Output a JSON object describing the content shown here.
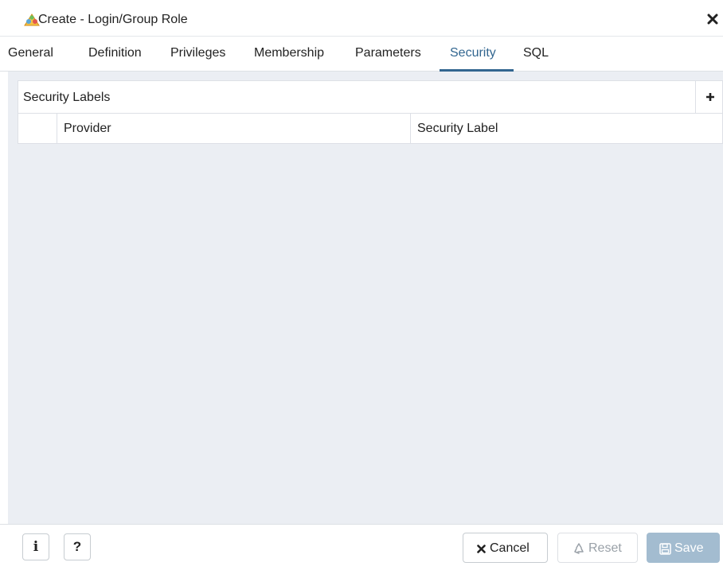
{
  "window": {
    "title": "Create - Login/Group Role",
    "app_icon": "roles-icon",
    "close_icon": "close-icon"
  },
  "tabs": [
    {
      "label": "General",
      "active": false
    },
    {
      "label": "Definition",
      "active": false
    },
    {
      "label": "Privileges",
      "active": false
    },
    {
      "label": "Membership",
      "active": false
    },
    {
      "label": "Parameters",
      "active": false
    },
    {
      "label": "Security",
      "active": true
    },
    {
      "label": "SQL",
      "active": false
    }
  ],
  "security_labels": {
    "title": "Security Labels",
    "add_icon": "plus-icon",
    "columns": [
      "Provider",
      "Security Label"
    ],
    "rows": []
  },
  "footer": {
    "info_label": "i",
    "help_label": "?",
    "cancel_label": "Cancel",
    "reset_label": "Reset",
    "save_label": "Save"
  },
  "colors": {
    "accent": "#326690",
    "content_bg": "#ebeef3",
    "save_disabled": "#a3bcd0"
  }
}
